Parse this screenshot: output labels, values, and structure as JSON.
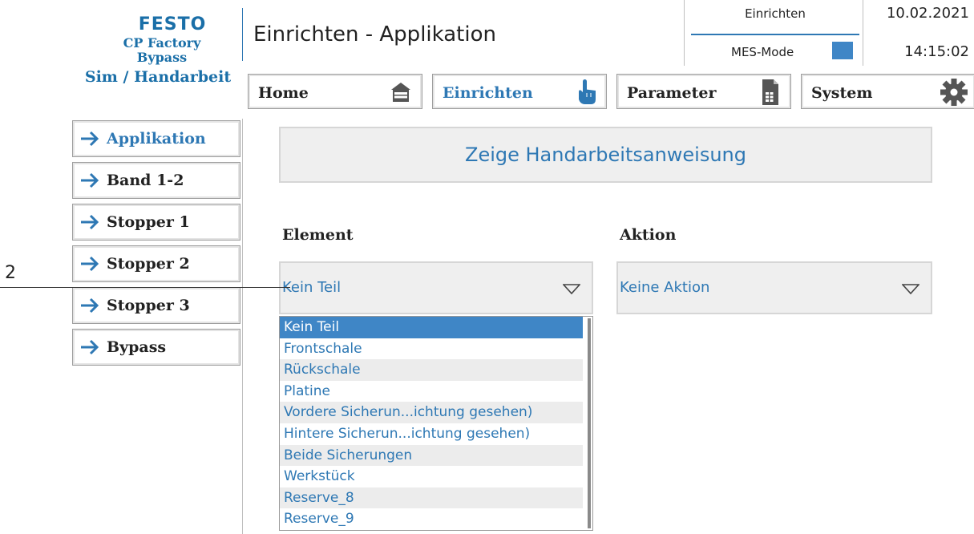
{
  "brand": {
    "logo": "FESTO",
    "line1": "CP Factory",
    "line2": "Bypass",
    "line3": "Sim / Handarbeit"
  },
  "header": {
    "title": "Einrichten - Applikation",
    "mode_label": "Einrichten",
    "mes_label": "MES-Mode",
    "date": "10.02.2021",
    "time": "14:15:02",
    "mes_indicator_color": "#3f86c6"
  },
  "topnav": [
    {
      "label": "Home",
      "icon": "home-icon"
    },
    {
      "label": "Einrichten",
      "icon": "pointing-hand-icon",
      "active": true
    },
    {
      "label": "Parameter",
      "icon": "document-icon"
    },
    {
      "label": "System",
      "icon": "gear-icon"
    }
  ],
  "sidebar": [
    {
      "label": "Applikation",
      "active": true
    },
    {
      "label": "Band 1-2"
    },
    {
      "label": "Stopper 1"
    },
    {
      "label": "Stopper 2"
    },
    {
      "label": "Stopper 3"
    },
    {
      "label": "Bypass"
    }
  ],
  "main": {
    "show_button": "Zeige Handarbeitsanweisung",
    "element_label": "Element",
    "aktion_label": "Aktion",
    "element_value": "Kein Teil",
    "aktion_value": "Keine Aktion",
    "element_options": [
      "Kein Teil",
      "Frontschale",
      "Rückschale",
      "Platine",
      "Vordere Sicherun...ichtung gesehen)",
      "Hintere Sicherun...ichtung gesehen)",
      "Beide Sicherungen",
      "Werkstück",
      "Reserve_8",
      "Reserve_9"
    ],
    "selected_option_index": 0
  },
  "callout": {
    "number": "2"
  },
  "colors": {
    "accent": "#2e78b4",
    "selected_bg": "#3f86c6",
    "panel_bg": "#efefef"
  }
}
